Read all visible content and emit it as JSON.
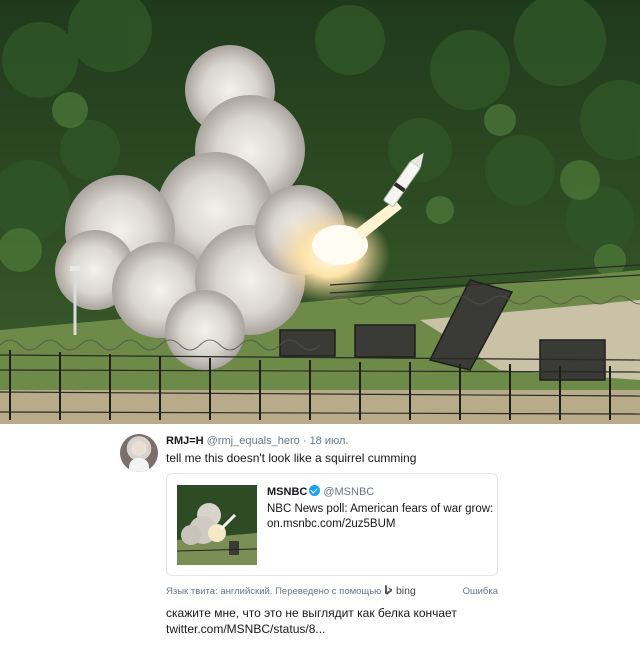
{
  "tweet": {
    "display_name": "RMJ=H",
    "handle": "@rmj_equals_hero",
    "separator": "·",
    "date": "18 июл.",
    "text": "tell me this doesn't look like a squirrel cumming",
    "quoted": {
      "display_name": "MSNBC",
      "handle": "@MSNBC",
      "verified_icon": "verified-badge-icon",
      "text": "NBC News poll: American fears of war grow: on.msnbc.com/2uz5BUM"
    },
    "translation_bar": {
      "label": "Язык твита: английский. Переведено с помощью",
      "provider": "bing",
      "error": "Ошибка"
    },
    "translated_text_line1": "скажите мне, что это не выглядит как белка кончает",
    "translated_text_line2": "twitter.com/MSNBC/status/8..."
  },
  "colors": {
    "text_primary": "#14171a",
    "text_secondary": "#657786",
    "verified_blue": "#1da1f2",
    "border": "#e1e8ed"
  }
}
